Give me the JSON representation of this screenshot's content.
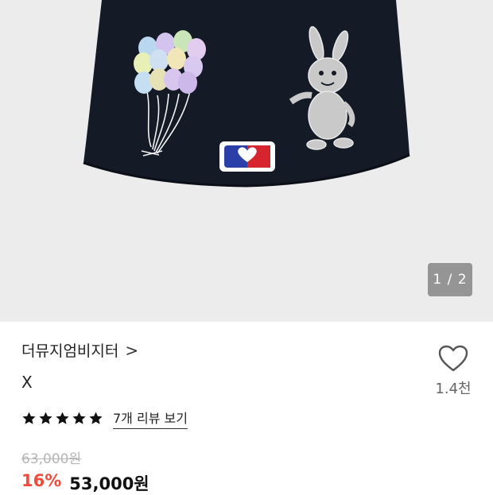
{
  "gallery": {
    "counter": "1 / 2",
    "product_image_alt": "embroidered cap back view"
  },
  "product": {
    "brand": "더뮤지엄비지터",
    "brand_chevron": ">",
    "title": "X",
    "rating": {
      "stars": 5,
      "review_link": "7개 리뷰 보기"
    },
    "original_price": "63,000원",
    "discount": "16%",
    "price": "53,000원"
  },
  "like": {
    "icon": "heart-outline-icon",
    "count": "1.4천"
  },
  "colors": {
    "cap": "#141a26",
    "hero_bg": "#ececec",
    "discount": "#f04b3b",
    "star": "#111111"
  }
}
